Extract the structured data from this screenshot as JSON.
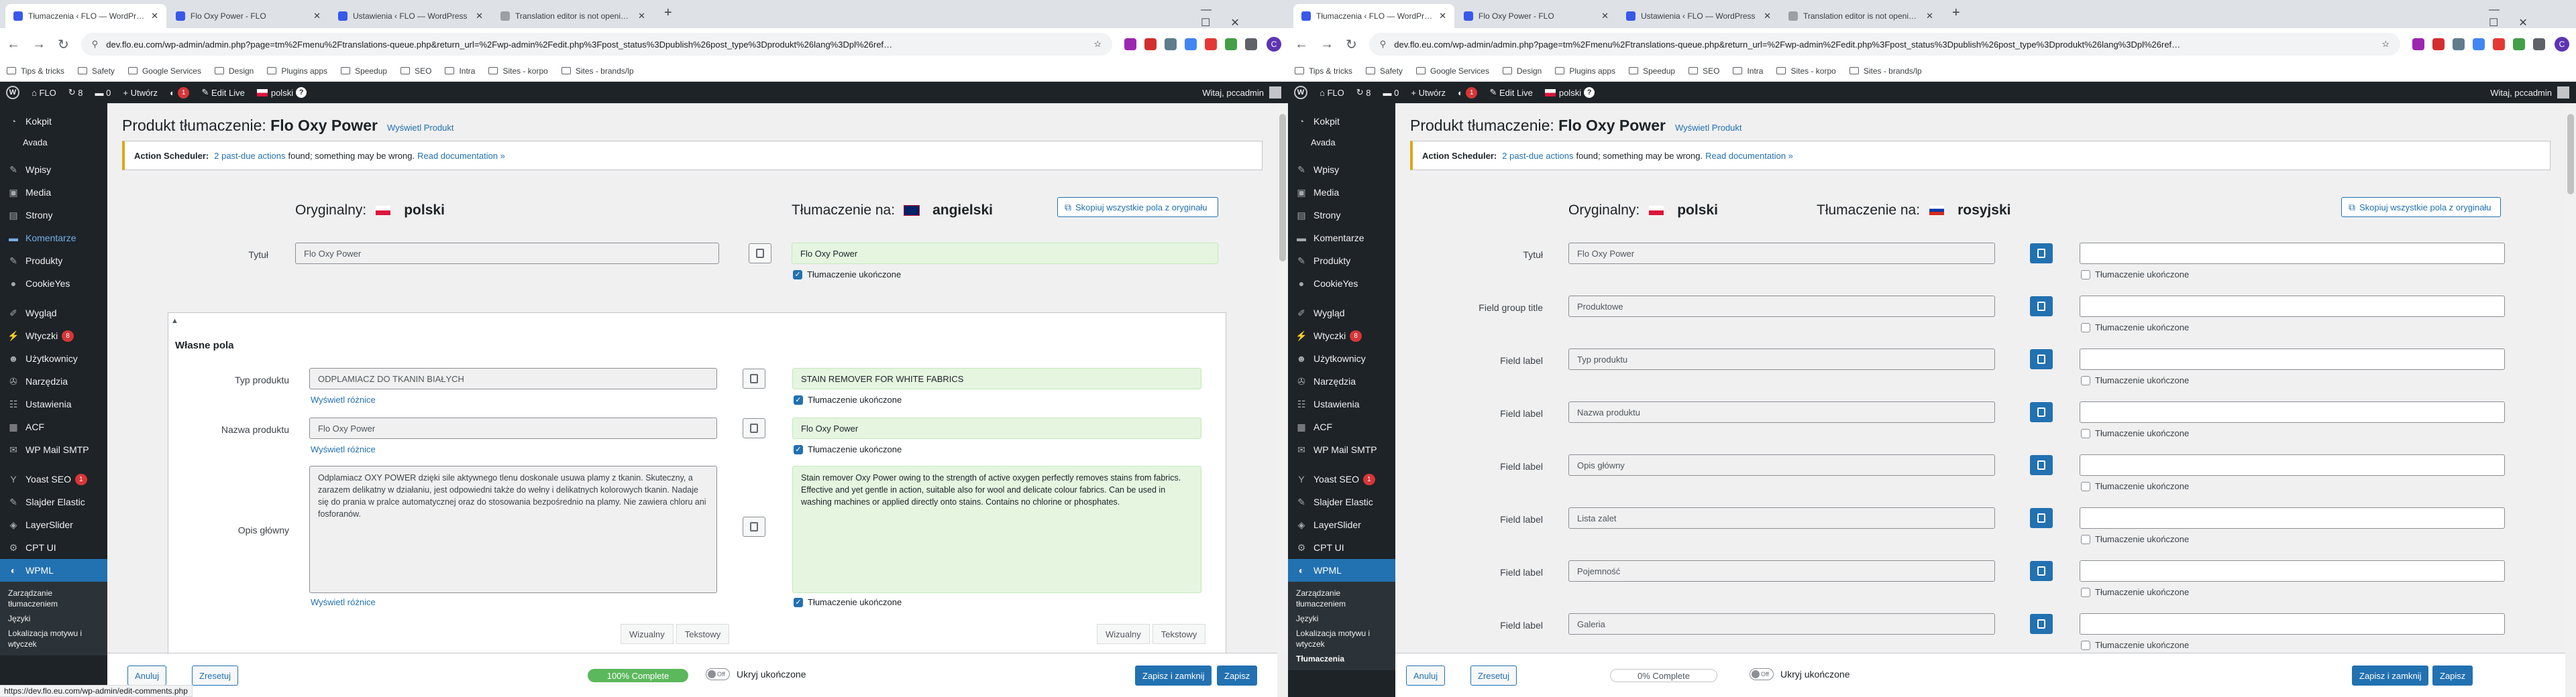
{
  "left": {
    "tabs": [
      "Tłumaczenia ‹ FLO — WordPre…",
      "Flo Oxy Power - FLO",
      "Ustawienia ‹ FLO — WordPress",
      "Translation editor is not openi…"
    ],
    "url": "dev.flo.eu.com/wp-admin/admin.php?page=tm%2Fmenu%2Ftranslations-queue.php&return_url=%2Fwp-admin%2Fedit.php%3Fpost_status%3Dpublish%26post_type%3Dprodukt%26lang%3Dpl%26ref…",
    "bookmarks": [
      "Tips & tricks",
      "Safety",
      "Google Services",
      "Design",
      "Plugins apps",
      "Speedup",
      "SEO",
      "Intra",
      "Sites - korpo",
      "Sites - brands/lp"
    ],
    "adminbar": {
      "site": "FLO",
      "updates": "8",
      "comments": "0",
      "new": "+ Utwórz",
      "wpml_count": "1",
      "edit_live": "Edit Live",
      "lang": "polski",
      "howdy": "Witaj, pccadmin"
    },
    "menu": [
      {
        "label": "Kokpit",
        "icon": "dashboard-icon"
      },
      {
        "label": "Avada",
        "icon": "avada-icon"
      },
      {
        "label": "Wpisy",
        "icon": "pin-icon"
      },
      {
        "label": "Media",
        "icon": "media-icon"
      },
      {
        "label": "Strony",
        "icon": "page-icon"
      },
      {
        "label": "Komentarze",
        "icon": "comment-icon"
      },
      {
        "label": "Produkty",
        "icon": "pin-icon"
      },
      {
        "label": "CookieYes",
        "icon": "cookie-icon"
      },
      {
        "label": "Wygląd",
        "icon": "brush-icon"
      },
      {
        "label": "Wtyczki",
        "icon": "plugin-icon",
        "badge": "8"
      },
      {
        "label": "Użytkownicy",
        "icon": "users-icon"
      },
      {
        "label": "Narzędzia",
        "icon": "wrench-icon"
      },
      {
        "label": "Ustawienia",
        "icon": "settings-icon"
      },
      {
        "label": "ACF",
        "icon": "acf-icon"
      },
      {
        "label": "WP Mail SMTP",
        "icon": "mail-icon"
      },
      {
        "label": "Yoast SEO",
        "icon": "yoast-icon",
        "badge": "1"
      },
      {
        "label": "Slajder Elastic",
        "icon": "pin-icon"
      },
      {
        "label": "LayerSlider",
        "icon": "layers-icon"
      },
      {
        "label": "CPT UI",
        "icon": "cpt-icon"
      },
      {
        "label": "WPML",
        "icon": "wpml-icon"
      }
    ],
    "submenu": [
      "Zarządzanie tłumaczeniem",
      "Języki",
      "Lokalizacja motywu i wtyczek"
    ],
    "title_prefix": "Produkt tłumaczenie:",
    "title_name": "Flo Oxy Power",
    "view_link": "Wyświetl Produkt",
    "notice": {
      "bold": "Action Scheduler:",
      "count_link": "2 past-due actions",
      "text": "found; something may be wrong.",
      "doc_link": "Read documentation »"
    },
    "original_label": "Oryginalny:",
    "original_lang": "polski",
    "translation_label": "Tłumaczenie na:",
    "translation_lang": "angielski",
    "copy_all": "Skopiuj wszystkie pola z oryginału",
    "title_label": "Tytuł",
    "title_src": "Flo Oxy Power",
    "title_dst": "Flo Oxy Power",
    "complete_label": "Tłumaczenie ukończone",
    "panel_title": "Własne pola",
    "f1_label": "Typ produktu",
    "f1_src": "ODPLAMIACZ DO TKANIN BIAŁYCH",
    "f1_dst": "STAIN REMOVER FOR WHITE FABRICS",
    "diff_label": "Wyświetl różnice",
    "f2_label": "Nazwa produktu",
    "f2_src": "Flo Oxy Power",
    "f2_dst": "Flo Oxy Power",
    "f3_label": "Opis główny",
    "f3_src": "Odplamiacz OXY POWER dzięki sile aktywnego tlenu doskonale usuwa plamy z tkanin. Skuteczny, a zarazem delikatny w działaniu, jest odpowiedni także do wełny i delikatnych kolorowych tkanin. Nadaje się do prania w pralce automatycznej oraz do stosowania bezpośrednio na plamy. Nie zawiera chloru ani fosforanów.",
    "f3_dst": "Stain remover Oxy Power owing to the strength of active oxygen perfectly removes stains from fabrics. Effective and yet gentle in action, suitable also for wool and delicate colour fabrics. Can be used in washing machines or applied directly onto stains. Contains no chlorine or phosphates.",
    "visual_tab": "Wizualny",
    "text_tab": "Tekstowy",
    "btn_back": "Anuluj",
    "btn_reset": "Zresetuj",
    "progress": "100% Complete",
    "progress_value": 100,
    "toggle_state": "Off",
    "toggle_label": "Ukryj ukończone",
    "btn_save_close": "Zapisz i zamknij",
    "btn_save": "Zapisz",
    "status_url": "https://dev.flo.eu.com/wp-admin/edit-comments.php"
  },
  "right": {
    "tabs": [
      "Tłumaczenia ‹ FLO — WordPre…",
      "Flo Oxy Power - FLO",
      "Ustawienia ‹ FLO — WordPress",
      "Translation editor is not openi…"
    ],
    "url": "dev.flo.eu.com/wp-admin/admin.php?page=tm%2Fmenu%2Ftranslations-queue.php&return_url=%2Fwp-admin%2Fedit.php%3Fpost_status%3Dpublish%26post_type%3Dprodukt%26lang%3Dpl%26ref…",
    "bookmarks": [
      "Tips & tricks",
      "Safety",
      "Google Services",
      "Design",
      "Plugins apps",
      "Speedup",
      "SEO",
      "Intra",
      "Sites - korpo",
      "Sites - brands/lp"
    ],
    "adminbar": {
      "site": "FLO",
      "updates": "8",
      "comments": "0",
      "new": "+ Utwórz",
      "wpml_count": "1",
      "edit_live": "Edit Live",
      "lang": "polski",
      "howdy": "Witaj, pccadmin"
    },
    "submenu": [
      "Zarządzanie tłumaczeniem",
      "Języki",
      "Lokalizacja motywu i wtyczek",
      "Tłumaczenia"
    ],
    "title_prefix": "Produkt tłumaczenie:",
    "title_name": "Flo Oxy Power",
    "view_link": "Wyświetl Produkt",
    "original_label": "Oryginalny:",
    "original_lang": "polski",
    "translation_label": "Tłumaczenie na:",
    "translation_lang": "rosyjski",
    "copy_all": "Skopiuj wszystkie pola z oryginału",
    "rows": [
      {
        "label": "Tytuł",
        "value": "Flo Oxy Power"
      },
      {
        "label": "Field group title",
        "value": "Produktowe"
      },
      {
        "label": "Field label",
        "value": "Typ produktu"
      },
      {
        "label": "Field label",
        "value": "Nazwa produktu"
      },
      {
        "label": "Field label",
        "value": "Opis główny"
      },
      {
        "label": "Field label",
        "value": "Lista zalet"
      },
      {
        "label": "Field label",
        "value": "Pojemność"
      },
      {
        "label": "Field label",
        "value": "Galeria"
      }
    ],
    "complete_label": "Tłumaczenie ukończone",
    "btn_back": "Anuluj",
    "btn_reset": "Zresetuj",
    "progress": "0% Complete",
    "progress_value": 0,
    "toggle_state": "Off",
    "toggle_label": "Ukryj ukończone",
    "btn_save_close": "Zapisz i zamknij",
    "btn_save": "Zapisz"
  },
  "colors": {
    "wp_blue": "#2271b1",
    "admin_dark": "#1d2327",
    "done_green": "#e5f5e0",
    "progress_green": "#5cb85c",
    "notice_yellow": "#dba617"
  }
}
